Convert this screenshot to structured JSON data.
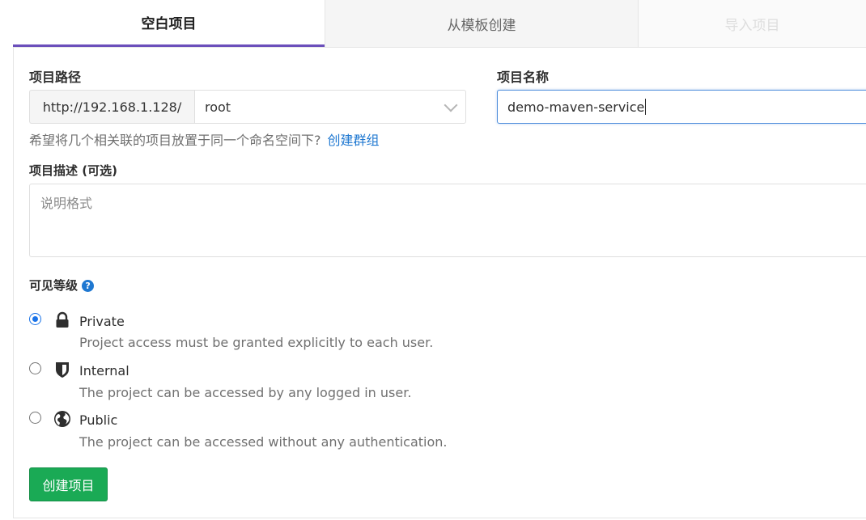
{
  "tabs": [
    {
      "label": "空白项目",
      "active": true
    },
    {
      "label": "从模板创建",
      "active": false
    },
    {
      "label": "导入项目",
      "active": false
    }
  ],
  "project_path": {
    "label": "项目路径",
    "prefix": "http://192.168.1.128/",
    "namespace": "root"
  },
  "project_name": {
    "label": "项目名称",
    "value": "demo-maven-service"
  },
  "hint": {
    "text": "希望将几个相关联的项目放置于同一个命名空间下?",
    "link": "创建群组"
  },
  "description": {
    "label": "项目描述 (可选)",
    "placeholder": "说明格式"
  },
  "visibility": {
    "label": "可见等级",
    "help_icon": "?",
    "options": [
      {
        "title": "Private",
        "desc": "Project access must be granted explicitly to each user.",
        "checked": true,
        "icon": "lock-icon"
      },
      {
        "title": "Internal",
        "desc": "The project can be accessed by any logged in user.",
        "checked": false,
        "icon": "shield-icon"
      },
      {
        "title": "Public",
        "desc": "The project can be accessed without any authentication.",
        "checked": false,
        "icon": "globe-icon"
      }
    ]
  },
  "submit": {
    "label": "创建项目"
  },
  "colors": {
    "active_tab_border": "#6b4fbb",
    "link": "#1f78d1",
    "submit_bg": "#1aaa55",
    "radio_selected": "#1a73e8"
  }
}
